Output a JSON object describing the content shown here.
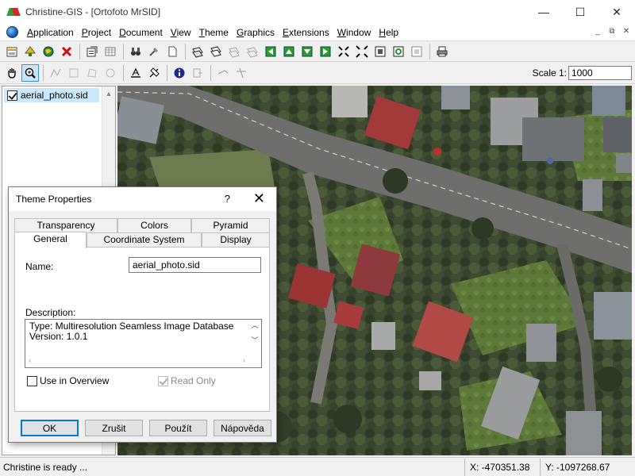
{
  "window": {
    "title": "Christine-GIS - [Ortofoto MrSID]",
    "minimize_glyph": "—",
    "maximize_glyph": "☐",
    "close_glyph": "✕"
  },
  "menu": {
    "items": [
      {
        "label": "Application",
        "accel": "A",
        "rest": "pplication"
      },
      {
        "label": "Project",
        "accel": "P",
        "rest": "roject"
      },
      {
        "label": "Document",
        "accel": "D",
        "rest": "ocument"
      },
      {
        "label": "View",
        "accel": "V",
        "rest": "iew"
      },
      {
        "label": "Theme",
        "accel": "T",
        "rest": "heme"
      },
      {
        "label": "Graphics",
        "accel": "G",
        "rest": "raphics"
      },
      {
        "label": "Extensions",
        "accel": "E",
        "rest": "xtensions"
      },
      {
        "label": "Window",
        "accel": "W",
        "rest": "indow"
      },
      {
        "label": "Help",
        "accel": "H",
        "rest": "elp"
      }
    ],
    "mdi_minimize": "_",
    "mdi_restore": "⧉",
    "mdi_close": "✕"
  },
  "toolbar2": {
    "scale_label": "Scale 1:",
    "scale_value": "1000"
  },
  "themes": {
    "items": [
      {
        "name": "aerial_photo.sid",
        "visible": true
      }
    ]
  },
  "statusbar": {
    "message": "Christine is ready ...",
    "x": "X: -470351.38",
    "y": "Y: -1097268.67"
  },
  "dialog": {
    "title": "Theme Properties",
    "help_glyph": "?",
    "close_glyph": "✕",
    "tabs_back": [
      "Transparency",
      "Colors",
      "Pyramid"
    ],
    "tabs_front": [
      "General",
      "Coordinate System",
      "Display"
    ],
    "selected_tab": "General",
    "name_label": "Name:",
    "name_value": "aerial_photo.sid",
    "description_label": "Description:",
    "description_lines": [
      "Type: Multiresolution Seamless Image Database",
      "Version: 1.0.1"
    ],
    "use_in_overview": "Use in Overview",
    "read_only": "Read Only",
    "buttons": {
      "ok": "OK",
      "cancel": "Zrušit",
      "apply": "Použít",
      "help": "Nápověda"
    }
  }
}
